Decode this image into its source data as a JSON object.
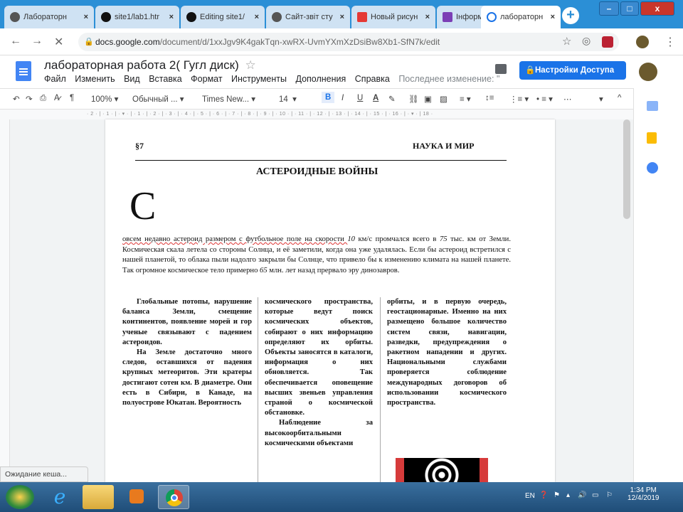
{
  "browser": {
    "tabs": [
      {
        "label": "Лабораторн",
        "active": false
      },
      {
        "label": "site1/lab1.htr",
        "active": false
      },
      {
        "label": "Editing site1/",
        "active": false
      },
      {
        "label": "Сайт-звіт сту",
        "active": false
      },
      {
        "label": "Новый рисун",
        "active": false
      },
      {
        "label": "Інформатика",
        "active": false
      },
      {
        "label": "лабораторн",
        "active": true
      }
    ],
    "new_tab": "+",
    "url_host": "docs.google.com",
    "url_path": "/document/d/1xxJgv9K4gakTqn-xwRX-UvmYXmXzDsiBw8Xb1-SfN7k/edit",
    "window_controls": [
      "–",
      "□",
      "x"
    ]
  },
  "docs": {
    "title": "лабораторная работа 2( Гугл диск)",
    "star": "☆",
    "menus": [
      "Файл",
      "Изменить",
      "Вид",
      "Вставка",
      "Формат",
      "Инструменты",
      "Дополнения",
      "Справка"
    ],
    "last_edit": "Последнее изменение: \"",
    "share_label": "Настройки Доступа",
    "toolbar": {
      "zoom": "100%",
      "style": "Обычный ...",
      "font": "Times New...",
      "size": "14",
      "bold": "B",
      "italic": "I",
      "underline": "U",
      "textcolor": "A"
    },
    "ruler": "· 2 · | · 1 · | · ▾ · | · 1 · | · 2 · | · 3 · | · 4 · | · 5 · | · 6 · | · 7 · | · 8 · | · 9 · | · 10 · | · 11 · | · 12 · | · 13 · | · 14 · | · 15 · | · 16 · | · ▾ · | 18 ·"
  },
  "page": {
    "section": "§7",
    "header_right": "НАУКА И МИР",
    "article_title": "АСТЕРОИДНЫЕ ВОЙНЫ",
    "dropcap": "С",
    "intro_parts": [
      "овсем недавно астероид размером с футбольное поле на скорости ",
      "10",
      " км/с промчался всего в ",
      "75",
      " тыс. км от Земли. Космическая скала летела со стороны Солнца, и её заметили, когда она уже удалялась. Если бы астероид встретился с нашей планетой, то облака пыли надолго закрыли бы Солнце, что привело бы к изменению климата на нашей планете. Так огромное космическое тело примерно ",
      "65",
      " млн. лет назад прервало эру динозавров."
    ],
    "col1": [
      "Глобальные потопы, нарушение баланса Земли, смещение континентов, появление морей и гор ученые связывают с падением астероидов.",
      "На Земле достаточно много следов, оставшихся от падения крупных метеоритов. Эти кратеры достигают сотен км. В диаметре. Они есть в Сибири, в Канаде, на полуострове Юкатан. Вероятность"
    ],
    "col2": [
      "космического пространства, которые ведут поиск космических объектов, собирают о них информацию определяют их орбиты. Объекты заносятся в каталоги, информация о них обновляется. Так обеспечивается оповещение высших звеньев управления страной о космической обстановке.",
      "Наблюдение за высокоорбитальными космическими объектами"
    ],
    "col3": [
      "орбиты, и в первую очередь, геостационарные. Именно на них размещено большое количество систем связи, навигации, разведки, предупреждения о ракетном нападении и других. Национальными службами проверяется соблюдение международных договоров об использовании космического пространства."
    ]
  },
  "status": "Ожидание кеша...",
  "tray": {
    "lang": "EN",
    "time": "1:34 PM",
    "date": "12/4/2019"
  },
  "colors": {
    "tabstrip": "#2b8fd6",
    "share": "#1a73e8",
    "taskbar": "#1f4d78"
  }
}
